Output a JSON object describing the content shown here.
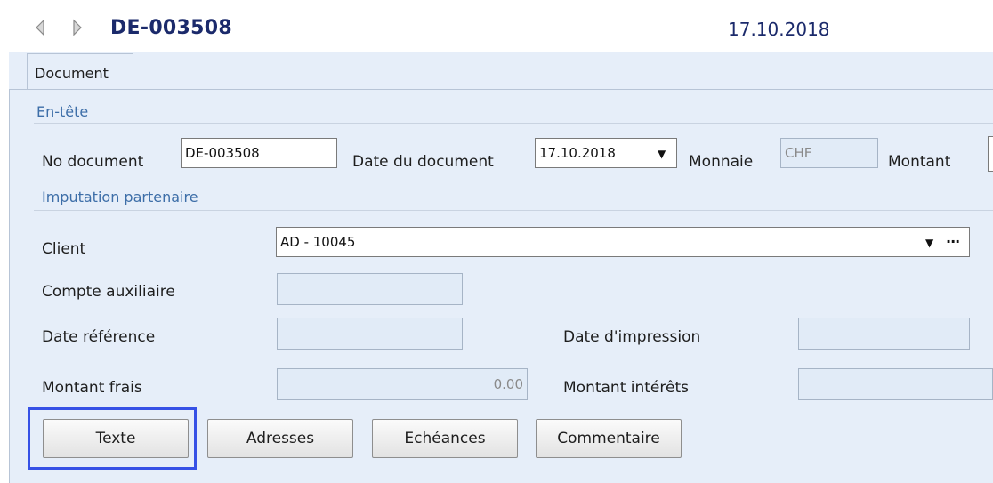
{
  "header": {
    "doc_id": "DE-003508",
    "date": "17.10.2018"
  },
  "tabs": [
    {
      "label": "Document",
      "active": true
    }
  ],
  "sections": {
    "entete": "En-tête",
    "imputation": "Imputation partenaire"
  },
  "entete_fields": {
    "no_document_label": "No document",
    "no_document_value": "DE-003508",
    "date_document_label": "Date du document",
    "date_document_value": "17.10.2018",
    "monnaie_label": "Monnaie",
    "monnaie_value": "CHF",
    "montant_label": "Montant"
  },
  "imputation_fields": {
    "client_label": "Client",
    "client_value": "AD - 10045",
    "compte_aux_label": "Compte auxiliaire",
    "compte_aux_value": "",
    "date_ref_label": "Date référence",
    "date_ref_value": "",
    "date_impression_label": "Date d'impression",
    "date_impression_value": "",
    "montant_frais_label": "Montant frais",
    "montant_frais_value": "0.00",
    "montant_interets_label": "Montant intérêts",
    "montant_interets_value": ""
  },
  "buttons": {
    "texte": "Texte",
    "adresses": "Adresses",
    "echeances": "Echéances",
    "commentaire": "Commentaire"
  },
  "colors": {
    "accent_title": "#1b2a6b",
    "section_text": "#3d6ea8",
    "panel_bg": "#e6eef9",
    "focus_ring": "#3651e6"
  },
  "icons": [
    "nav-back-icon",
    "nav-forward-icon",
    "combo-arrow-icon",
    "ellipsis-icon"
  ]
}
